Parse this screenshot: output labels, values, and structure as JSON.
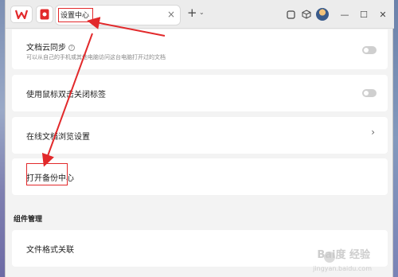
{
  "titlebar": {
    "logo_icon": "wps-logo-icon",
    "app_icon": "wps-doc-icon",
    "active_tab_label": "设置中心",
    "close_tab_symbol": "×",
    "new_tab_symbol": "+",
    "new_tab_menu_symbol": "⌄",
    "tools": [
      "window-icon",
      "box-icon",
      "avatar"
    ],
    "window_controls": [
      "—",
      "☐",
      "✕"
    ]
  },
  "settings": {
    "rows": [
      {
        "title": "文档云同步",
        "subtitle": "可以从自己的手机或其他电脑访问这台电脑打开过的文档",
        "control": "toggle",
        "on": false
      },
      {
        "title": "使用鼠标双击关闭标签",
        "control": "toggle",
        "on": false
      },
      {
        "title": "在线文档浏览设置",
        "control": "chevron"
      },
      {
        "title": "打开备份中心",
        "control": "none"
      }
    ],
    "section_heading": "组件管理",
    "section_rows": [
      {
        "title": "文件格式关联"
      }
    ],
    "chevron_symbol": "›",
    "help_symbol": "?"
  },
  "watermark": {
    "text": "Bai度 经验",
    "sub": "jingyan.baidu.com"
  },
  "colors": {
    "highlight_red": "#e2292b",
    "window_bg": "#f3f3f3",
    "card_bg": "#ffffff"
  }
}
